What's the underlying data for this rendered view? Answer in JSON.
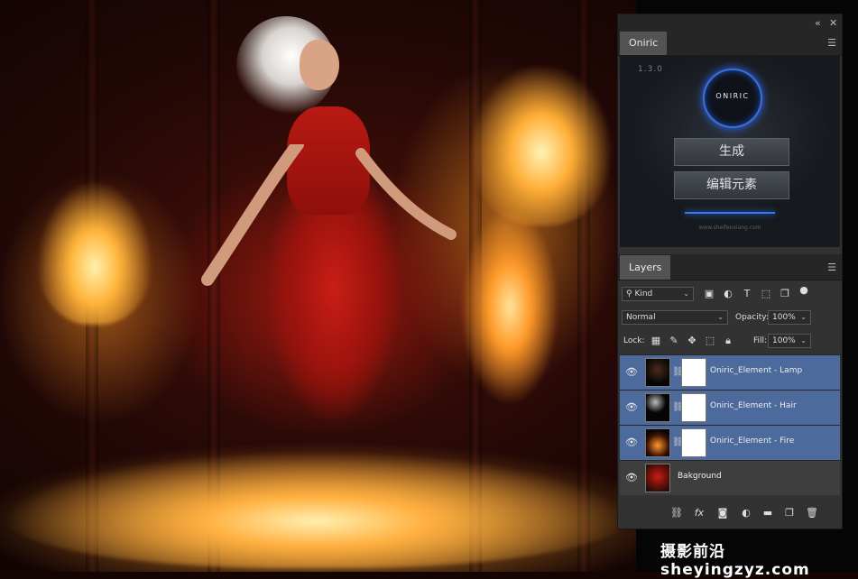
{
  "oniric_panel": {
    "tab_label": "Oniric",
    "version": "1.3.0",
    "logo_text": "ONIRIC",
    "generate_button": "生成",
    "edit_elements_button": "编辑元素",
    "website": "www.sheifenxiang.com"
  },
  "layers_panel": {
    "tab_label": "Layers",
    "filter_value": "Kind",
    "blend_mode": "Normal",
    "opacity_label": "Opacity:",
    "opacity_value": "100%",
    "lock_label": "Lock:",
    "fill_label": "Fill:",
    "fill_value": "100%",
    "layers": [
      {
        "name": "Oniric_Element - Lamp",
        "selected": true
      },
      {
        "name": "Oniric_Element - Hair",
        "selected": true
      },
      {
        "name": "Oniric_Element - Fire",
        "selected": true
      },
      {
        "name": "Bakground",
        "selected": false
      }
    ]
  },
  "watermark": {
    "text": "摄影前沿 sheyingzyz.com"
  },
  "colors": {
    "panel_bg": "#323232",
    "selected_layer": "#4c6b9c",
    "accent_blue": "#3a6fe0"
  },
  "icons": [
    "eye-icon",
    "link-icon",
    "search-icon",
    "brush-icon",
    "move-icon",
    "lock-icon",
    "trash-icon",
    "fx-icon",
    "folder-icon",
    "new-layer-icon",
    "mask-icon",
    "adjustment-icon"
  ]
}
